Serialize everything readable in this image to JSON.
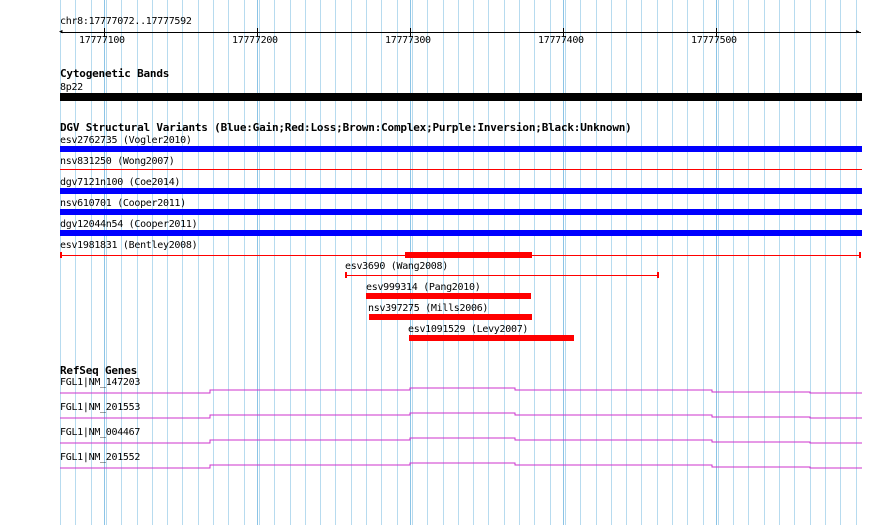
{
  "ruler": {
    "position": "chr8:17777072..17777592",
    "ticks": [
      "17777100",
      "17777200",
      "17777300",
      "17777400",
      "17777500"
    ]
  },
  "cytobands": {
    "title": "Cytogenetic Bands",
    "band": "8p22",
    "color": "#000000"
  },
  "dgv": {
    "title": "DGV Structural Variants (Blue:Gain;Red:Loss;Brown:Complex;Purple:Inversion;Black:Unknown)",
    "gain_color": "#0000ff",
    "loss_color": "#ff0000",
    "variants": [
      {
        "label": "esv2762735 (Vogler2010)",
        "type": "gain"
      },
      {
        "label": "nsv831250 (Wong2007)",
        "type": "loss"
      },
      {
        "label": "dgv7121n100 (Coe2014)",
        "type": "gain"
      },
      {
        "label": "nsv610701 (Cooper2011)",
        "type": "gain"
      },
      {
        "label": "dgv12044n54 (Cooper2011)",
        "type": "gain"
      },
      {
        "label": "esv1981831 (Bentley2008)",
        "type": "loss"
      },
      {
        "label": "esv3690 (Wang2008)",
        "type": "loss"
      },
      {
        "label": "esv999314 (Pang2010)",
        "type": "loss"
      },
      {
        "label": "nsv397275 (Mills2006)",
        "type": "loss"
      },
      {
        "label": "esv1091529 (Levy2007)",
        "type": "loss"
      }
    ]
  },
  "refseq": {
    "title": "RefSeq Genes",
    "color": "#cc33cc",
    "genes": [
      "FGL1|NM_147203",
      "FGL1|NM_201553",
      "FGL1|NM_004467",
      "FGL1|NM_201552"
    ]
  }
}
